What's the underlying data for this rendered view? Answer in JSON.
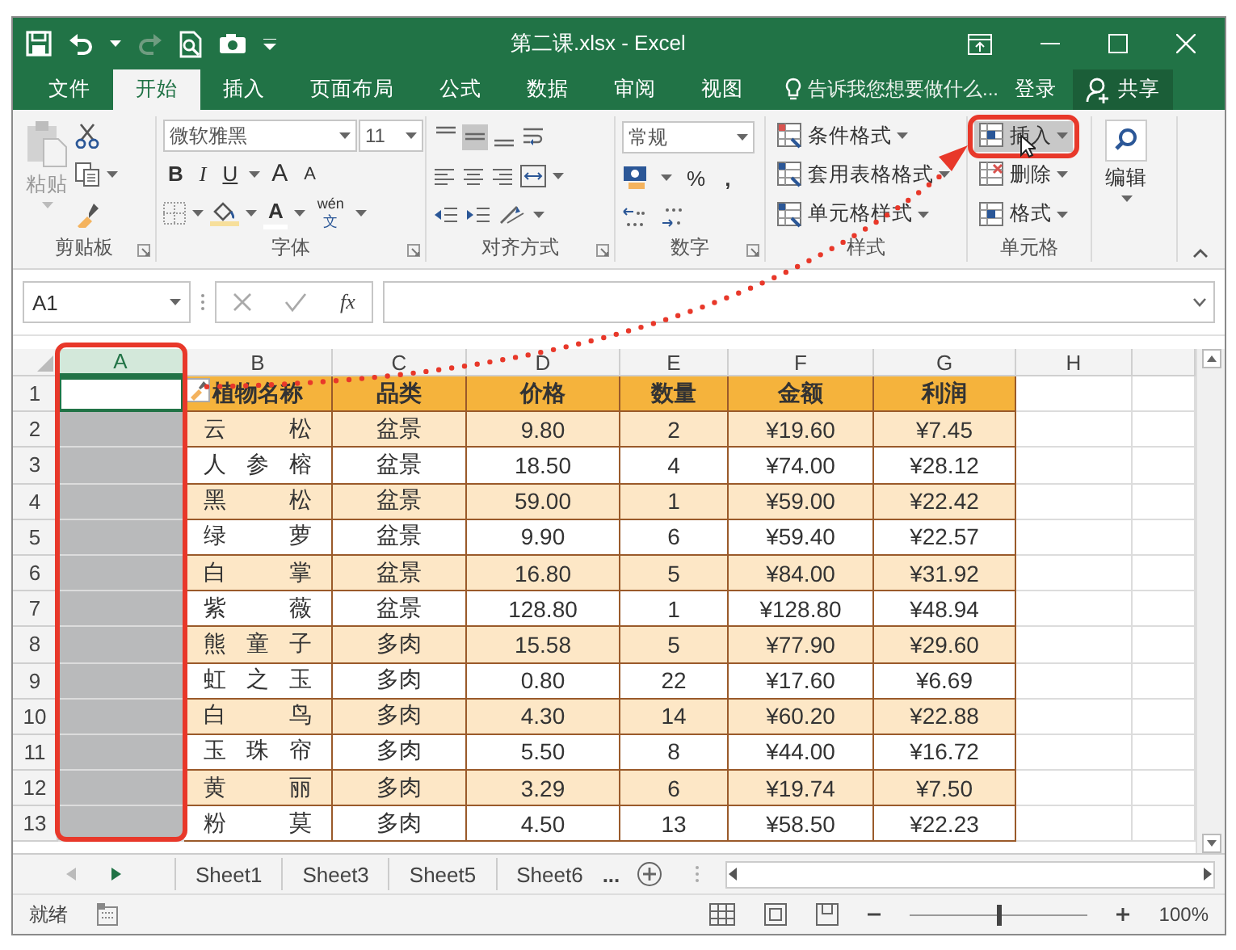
{
  "title_bar": {
    "title": "第二课.xlsx - Excel"
  },
  "menu_tabs": [
    {
      "label": "文件",
      "selected": false
    },
    {
      "label": "开始",
      "selected": true
    },
    {
      "label": "插入",
      "selected": false
    },
    {
      "label": "页面布局",
      "selected": false
    },
    {
      "label": "公式",
      "selected": false
    },
    {
      "label": "数据",
      "selected": false
    },
    {
      "label": "审阅",
      "selected": false
    },
    {
      "label": "视图",
      "selected": false
    }
  ],
  "tell_me": {
    "placeholder": "告诉我您想要做什么..."
  },
  "sign_in": "登录",
  "share": "共享",
  "ribbon": {
    "groups": [
      {
        "kind": "clipboard",
        "name": "剪贴板",
        "paste": "粘贴"
      },
      {
        "kind": "font",
        "name": "字体",
        "font_name": "微软雅黑",
        "font_size": "11",
        "styles": [
          "B",
          "I",
          "U"
        ],
        "grow": "A",
        "shrink": "A",
        "font_color": "A",
        "phonetic": "wén",
        "phonetic_char": "文"
      },
      {
        "kind": "alignment",
        "name": "对齐方式",
        "vertical_align": [
          {
            "pressed": false
          },
          {
            "pressed": true
          },
          {
            "pressed": false
          }
        ]
      },
      {
        "kind": "number",
        "name": "数字",
        "format": "常规",
        "percent": "%",
        "comma": ","
      },
      {
        "kind": "styles",
        "name": "样式",
        "items": [
          "条件格式",
          "套用表格格式",
          "单元格样式"
        ]
      },
      {
        "kind": "cells",
        "name": "单元格",
        "items": [
          {
            "label": "插入",
            "hovered": true
          },
          {
            "label": "删除",
            "hovered": false
          },
          {
            "label": "格式",
            "hovered": false
          }
        ]
      },
      {
        "kind": "editing",
        "name": "编辑"
      }
    ]
  },
  "formula_bar": {
    "name_box": "A1",
    "fx": "fx"
  },
  "columns": [
    {
      "label": "A",
      "selected": true
    },
    {
      "label": "B",
      "selected": false
    },
    {
      "label": "C",
      "selected": false
    },
    {
      "label": "D",
      "selected": false
    },
    {
      "label": "E",
      "selected": false
    },
    {
      "label": "F",
      "selected": false
    },
    {
      "label": "G",
      "selected": false
    },
    {
      "label": "H",
      "selected": false
    }
  ],
  "row_numbers": [
    "1",
    "2",
    "3",
    "4",
    "5",
    "6",
    "7",
    "8",
    "9",
    "10",
    "11",
    "12",
    "13"
  ],
  "table": {
    "columns": [
      "植物名称",
      "品类",
      "价格",
      "数量",
      "金额",
      "利润"
    ],
    "rows": [
      [
        "云松",
        "盆景",
        "9.80",
        "2",
        "¥19.60",
        "¥7.45"
      ],
      [
        "人参榕",
        "盆景",
        "18.50",
        "4",
        "¥74.00",
        "¥28.12"
      ],
      [
        "黑松",
        "盆景",
        "59.00",
        "1",
        "¥59.00",
        "¥22.42"
      ],
      [
        "绿萝",
        "盆景",
        "9.90",
        "6",
        "¥59.40",
        "¥22.57"
      ],
      [
        "白掌",
        "盆景",
        "16.80",
        "5",
        "¥84.00",
        "¥31.92"
      ],
      [
        "紫薇",
        "盆景",
        "128.80",
        "1",
        "¥128.80",
        "¥48.94"
      ],
      [
        "熊童子",
        "多肉",
        "15.58",
        "5",
        "¥77.90",
        "¥29.60"
      ],
      [
        "虹之玉",
        "多肉",
        "0.80",
        "22",
        "¥17.60",
        "¥6.69"
      ],
      [
        "白鸟",
        "多肉",
        "4.30",
        "14",
        "¥60.20",
        "¥22.88"
      ],
      [
        "玉珠帘",
        "多肉",
        "5.50",
        "8",
        "¥44.00",
        "¥16.72"
      ],
      [
        "黄丽",
        "多肉",
        "3.29",
        "6",
        "¥19.74",
        "¥7.50"
      ],
      [
        "粉莫",
        "多肉",
        "4.50",
        "13",
        "¥58.50",
        "¥22.23"
      ]
    ]
  },
  "sheet_tabs": [
    {
      "label": "Sheet1",
      "selected": false
    },
    {
      "label": "Sheet3",
      "selected": false
    },
    {
      "label": "Sheet5",
      "selected": false
    },
    {
      "label": "Sheet6",
      "selected": false
    }
  ],
  "sheet_more": "...",
  "status_bar": {
    "text": "就绪",
    "zoom": "100%"
  },
  "zoom_slider": {
    "level": 0.5
  }
}
